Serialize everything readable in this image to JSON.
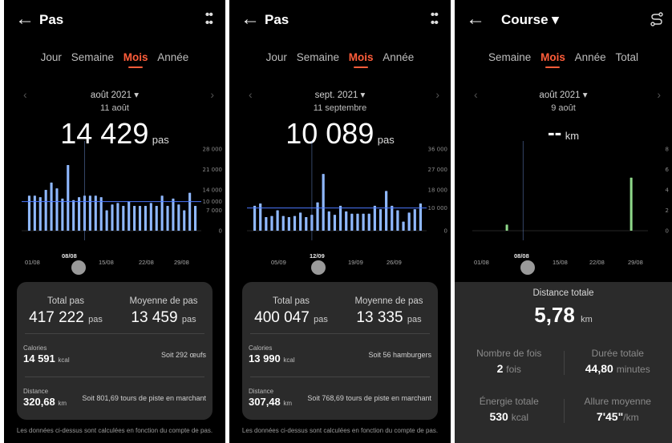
{
  "panels": [
    {
      "title": "Pas",
      "tabs": [
        "Jour",
        "Semaine",
        "Mois",
        "Année"
      ],
      "active_tab": "Mois",
      "month": "août 2021 ▾",
      "selected_day": "11 août",
      "big_value": "14 429",
      "big_unit": "pas",
      "x_ticks": [
        "01/08",
        "08/08",
        "15/08",
        "22/08",
        "29/08"
      ],
      "stat_left_label": "Total pas",
      "stat_left_value": "417 222",
      "stat_left_unit": "pas",
      "stat_right_label": "Moyenne de pas",
      "stat_right_value": "13 459",
      "stat_right_unit": "pas",
      "calories_label": "Calories",
      "calories_value": "14 591",
      "calories_unit": "kcal",
      "calories_side": "Soit 292 œufs",
      "distance_label": "Distance",
      "distance_value": "320,68",
      "distance_unit": "km",
      "distance_side": "Soit 801,69 tours de piste en marchant",
      "footer": "Les données ci-dessus sont calculées en fonction du compte de pas."
    },
    {
      "title": "Pas",
      "tabs": [
        "Jour",
        "Semaine",
        "Mois",
        "Année"
      ],
      "active_tab": "Mois",
      "month": "sept. 2021 ▾",
      "selected_day": "11 septembre",
      "big_value": "10 089",
      "big_unit": "pas",
      "x_ticks": [
        "05/09",
        "12/09",
        "19/09",
        "26/09"
      ],
      "stat_left_label": "Total pas",
      "stat_left_value": "400 047",
      "stat_left_unit": "pas",
      "stat_right_label": "Moyenne de pas",
      "stat_right_value": "13 335",
      "stat_right_unit": "pas",
      "calories_label": "Calories",
      "calories_value": "13 990",
      "calories_unit": "kcal",
      "calories_side": "Soit 56 hamburgers",
      "distance_label": "Distance",
      "distance_value": "307,48",
      "distance_unit": "km",
      "distance_side": "Soit 768,69 tours de piste en marchant",
      "footer": "Les données ci-dessus sont calculées en fonction du compte de pas."
    },
    {
      "title": "Course ▾",
      "tabs": [
        "Semaine",
        "Mois",
        "Année",
        "Total"
      ],
      "active_tab": "Mois",
      "month": "août 2021 ▾",
      "selected_day": "9 août",
      "big_value": "--",
      "big_unit": "km",
      "x_ticks": [
        "01/08",
        "08/08",
        "15/08",
        "22/08",
        "29/08"
      ],
      "distance_total_label": "Distance totale",
      "distance_total_value": "5,78",
      "distance_total_unit": "km",
      "count_label": "Nombre de fois",
      "count_value": "2",
      "count_unit": "fois",
      "duration_label": "Durée totale",
      "duration_value": "44,80",
      "duration_unit": "minutes",
      "energy_label": "Énergie totale",
      "energy_value": "530",
      "energy_unit": "kcal",
      "pace_label": "Allure moyenne",
      "pace_value": "7'45\"",
      "pace_unit": "/km"
    }
  ],
  "icons": {
    "back": "arrow-left-icon",
    "menu": "more-dots-icon",
    "route": "route-icon",
    "prev": "chevron-left-icon",
    "next": "chevron-right-icon"
  },
  "colors": {
    "accent": "#ff5d3a",
    "bar_steps": "#8fb8ff",
    "bar_run": "#8fd88a",
    "avg_line": "#4b78ff"
  },
  "chart_data": [
    {
      "type": "bar",
      "title": "",
      "x": [
        1,
        2,
        3,
        4,
        5,
        6,
        7,
        8,
        9,
        10,
        11,
        12,
        13,
        14,
        15,
        16,
        17,
        18,
        19,
        20,
        21,
        22,
        23,
        24,
        25,
        26,
        27,
        28,
        29,
        30,
        31
      ],
      "values": [
        12000,
        12000,
        11500,
        14000,
        16500,
        14500,
        11000,
        22500,
        10500,
        11500,
        12000,
        12000,
        12000,
        11500,
        7000,
        9000,
        9500,
        8500,
        10000,
        8500,
        8500,
        8500,
        9500,
        8500,
        12000,
        8500,
        11000,
        9000,
        7000,
        13000,
        8500
      ],
      "y_ticks": [
        "28 000",
        "21 000",
        "14 000",
        "10 000",
        "7 000",
        "0"
      ],
      "ylim": [
        0,
        28000
      ],
      "average_label": "10 000",
      "average": 10000,
      "selected_day": 11
    },
    {
      "type": "bar",
      "title": "",
      "x": [
        1,
        2,
        3,
        4,
        5,
        6,
        7,
        8,
        9,
        10,
        11,
        12,
        13,
        14,
        15,
        16,
        17,
        18,
        19,
        20,
        21,
        22,
        23,
        24,
        25,
        26,
        27,
        28,
        29,
        30
      ],
      "values": [
        11000,
        12000,
        6000,
        6500,
        9000,
        6500,
        6000,
        6500,
        8000,
        6000,
        7000,
        12500,
        25000,
        8500,
        7000,
        11000,
        8500,
        7500,
        7500,
        7500,
        7500,
        11000,
        9500,
        17500,
        11000,
        9000,
        4000,
        8000,
        9500,
        12000
      ],
      "y_ticks": [
        "36 000",
        "27 000",
        "18 000",
        "10 000",
        "0"
      ],
      "ylim": [
        0,
        36000
      ],
      "average_label": "10 000",
      "average": 10000,
      "selected_day": 11
    },
    {
      "type": "bar",
      "title": "",
      "x": [
        1,
        2,
        3,
        4,
        5,
        6,
        7,
        8,
        9,
        10,
        11,
        12,
        13,
        14,
        15,
        16,
        17,
        18,
        19,
        20,
        21,
        22,
        23,
        24,
        25,
        26,
        27,
        28,
        29,
        30,
        31
      ],
      "values": [
        0,
        0,
        0,
        0,
        0,
        0.6,
        0,
        0,
        0,
        0,
        0,
        0,
        0,
        0,
        0,
        0,
        0,
        0,
        0,
        0,
        0,
        0,
        0,
        0,
        0,
        0,
        0,
        0,
        5.2,
        0,
        0
      ],
      "y_ticks": [
        "8",
        "6",
        "4",
        "2",
        "0"
      ],
      "ylim": [
        0,
        8
      ],
      "selected_day": 9
    }
  ]
}
